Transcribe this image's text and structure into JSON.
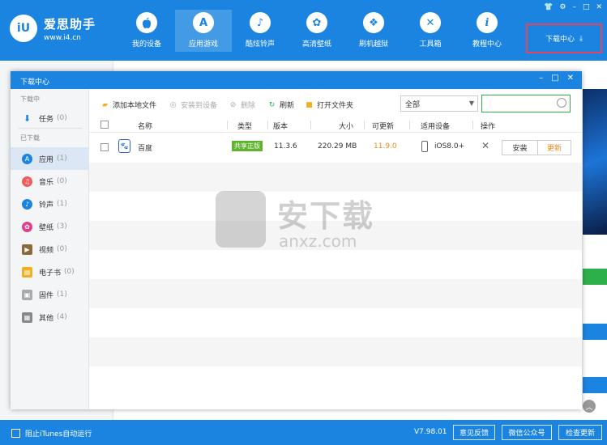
{
  "app": {
    "logo_mark": "iU",
    "logo_name": "爱思助手",
    "logo_url": "www.i4.cn",
    "nav": [
      {
        "label": "我的设备",
        "icon": "apple-icon",
        "glyph": ""
      },
      {
        "label": "应用游戏",
        "icon": "app-store-icon",
        "glyph": "A"
      },
      {
        "label": "酷炫铃声",
        "icon": "bell-icon",
        "glyph": "♪"
      },
      {
        "label": "高清壁纸",
        "icon": "flower-icon",
        "glyph": "✿"
      },
      {
        "label": "刷机越狱",
        "icon": "dropbox-icon",
        "glyph": "❖"
      },
      {
        "label": "工具箱",
        "icon": "tools-icon",
        "glyph": "✕"
      },
      {
        "label": "教程中心",
        "icon": "info-icon",
        "glyph": "i"
      }
    ],
    "download_center_label": "下载中心",
    "download_icon": "⤓",
    "statusbar": {
      "itunes_label": "阻止iTunes自动运行",
      "version": "V7.98.01",
      "feedback": "意见反馈",
      "wechat": "微信公众号",
      "check_update": "检查更新"
    }
  },
  "dialog": {
    "title": "下载中心",
    "controls": [
      "–",
      "□",
      "✕"
    ],
    "sidebar": {
      "downloading_header": "下载中",
      "downloaded_header": "已下载",
      "task": {
        "label": "任务",
        "count": "(0)"
      },
      "items": [
        {
          "label": "应用",
          "count": "(1)",
          "color": "#1a84e0",
          "glyph": "A"
        },
        {
          "label": "音乐",
          "count": "(0)",
          "color": "#f05b5b",
          "glyph": "♫"
        },
        {
          "label": "铃声",
          "count": "(1)",
          "color": "#1a84e0",
          "glyph": "♪"
        },
        {
          "label": "壁纸",
          "count": "(3)",
          "color": "#e0408a",
          "glyph": "✿"
        },
        {
          "label": "视频",
          "count": "(0)",
          "color": "#8a6a3a",
          "glyph": "▶"
        },
        {
          "label": "电子书",
          "count": "(0)",
          "color": "#f0b020",
          "glyph": "▤"
        },
        {
          "label": "固件",
          "count": "(1)",
          "color": "#aaaaaa",
          "glyph": "▣"
        },
        {
          "label": "其他",
          "count": "(4)",
          "color": "#888888",
          "glyph": "▦"
        }
      ]
    },
    "toolbar": {
      "add_local": "添加本地文件",
      "install_to_device": "安装到设备",
      "delete": "删除",
      "refresh": "刷新",
      "open_folder": "打开文件夹",
      "filter_value": "全部",
      "search_placeholder": ""
    },
    "columns": [
      "名称",
      "类型",
      "版本",
      "大小",
      "可更新",
      "适用设备",
      "操作"
    ],
    "rows": [
      {
        "name": "百度",
        "type": "共享正版",
        "version": "11.3.6",
        "size": "220.29 MB",
        "update_version": "11.9.0",
        "device": "iOS8.0+",
        "install": "安装",
        "update": "更新"
      }
    ],
    "watermark": {
      "text": "安下载",
      "url": "anxz.com",
      "glyph": "安"
    }
  },
  "colors": {
    "brand_blue": "#1a84e0",
    "highlight_red": "#e8435a",
    "update_orange": "#f08a1e",
    "badge_green": "#5fb32f"
  }
}
